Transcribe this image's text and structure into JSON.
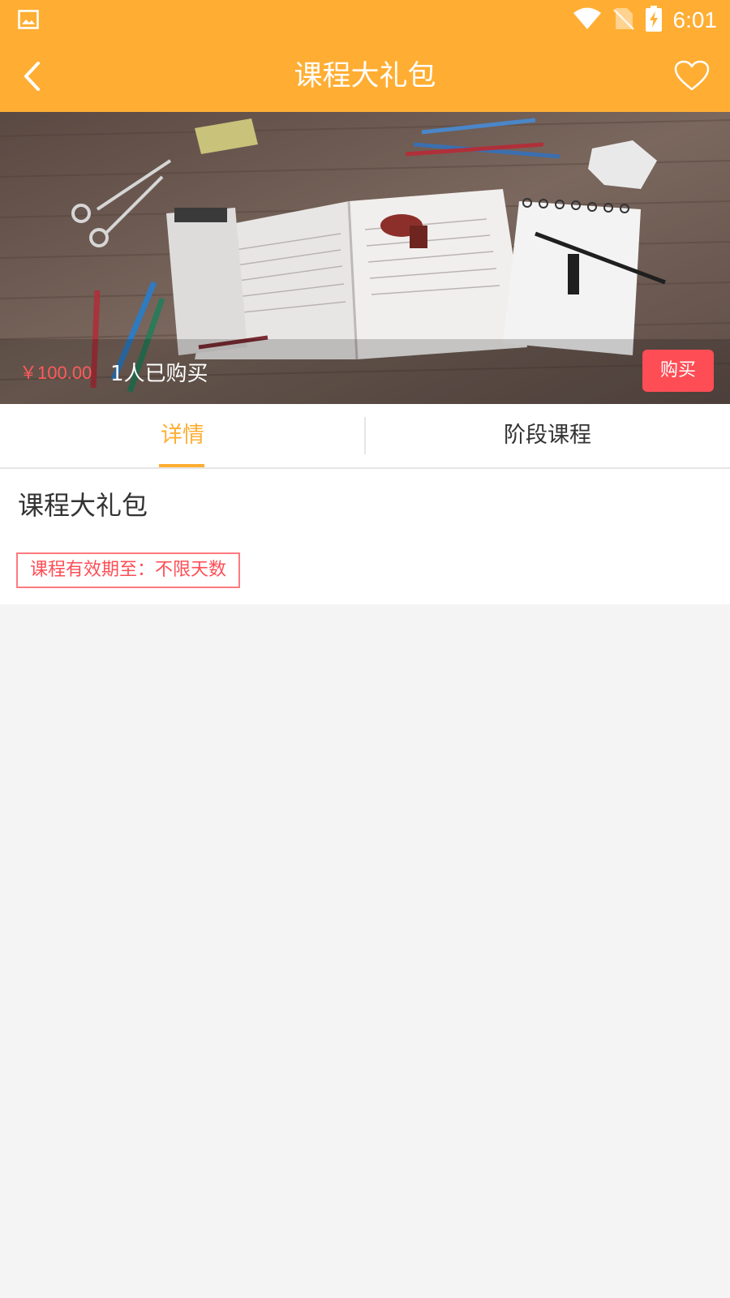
{
  "status_bar": {
    "time": "6:01"
  },
  "header": {
    "title": "课程大礼包"
  },
  "hero": {
    "price": "￥100.00",
    "buyers": "1人已购买",
    "buy_label": "购买"
  },
  "tabs": [
    {
      "label": "详情",
      "active": true
    },
    {
      "label": "阶段课程",
      "active": false
    }
  ],
  "detail": {
    "course_name": "课程大礼包",
    "validity": "课程有效期至：不限天数"
  },
  "colors": {
    "accent": "#ffae33",
    "price": "#ff5a5a",
    "buy_button": "#ff4d55"
  },
  "icons": [
    "image-icon",
    "wifi-icon",
    "no-sim-icon",
    "battery-charging-icon",
    "back-arrow-icon",
    "heart-outline-icon"
  ]
}
